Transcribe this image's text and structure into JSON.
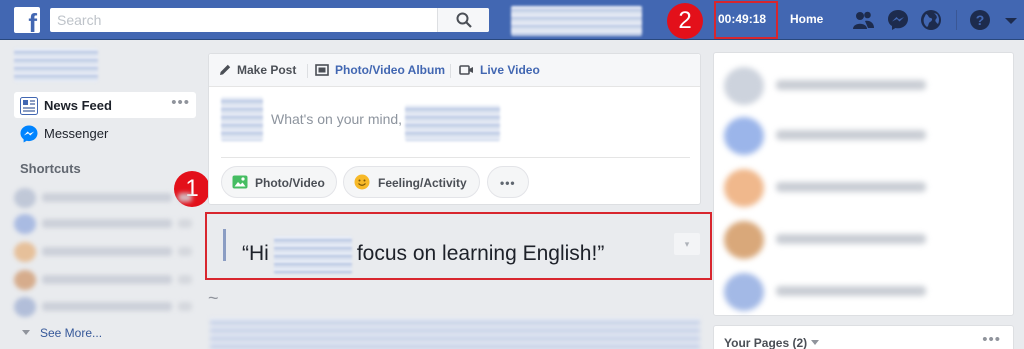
{
  "topbar": {
    "logo_letter": "f",
    "search_placeholder": "Search",
    "timer": "00:49:18",
    "home_label": "Home",
    "icons": [
      "friends-icon",
      "messenger-icon",
      "globe-icon",
      "help-icon",
      "caret-down-icon"
    ]
  },
  "markers": {
    "one": "1",
    "two": "2"
  },
  "left_nav": {
    "news_feed": "News Feed",
    "more_dots": "•••",
    "messenger": "Messenger",
    "shortcuts_heading": "Shortcuts",
    "see_more": "See More..."
  },
  "composer": {
    "tab_make_post": "Make Post",
    "tab_photo_album": "Photo/Video Album",
    "tab_live_video": "Live Video",
    "placeholder": "What's on your mind,",
    "btn_photo": "Photo/Video",
    "btn_feeling": "Feeling/Activity",
    "btn_more": "•••"
  },
  "quote": {
    "open": "“Hi",
    "rest": "focus on learning English!”",
    "close_glyph": "▾"
  },
  "feed": {
    "tilde": "~"
  },
  "right": {
    "pages_heading": "Your Pages (2)",
    "pages_dots": "•••"
  },
  "colors": {
    "brand_blue": "#4267b2",
    "highlight_red": "#d8262e",
    "marker_red": "#e3101a"
  }
}
